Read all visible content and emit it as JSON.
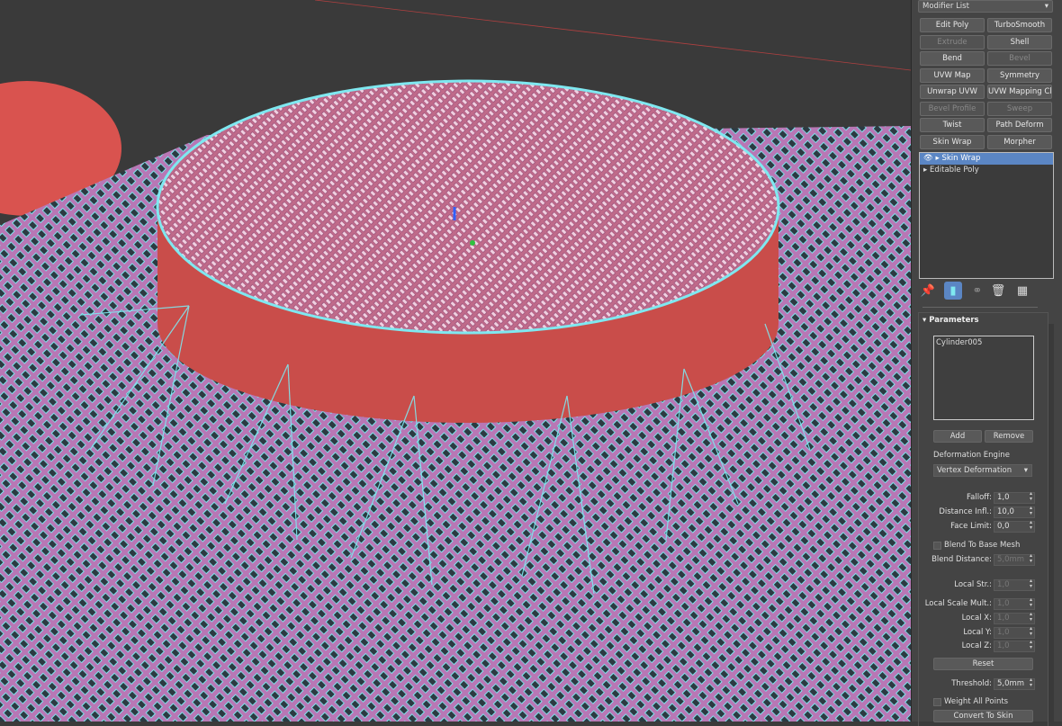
{
  "panel": {
    "modifier_list": "Modifier List",
    "buttons": [
      {
        "label": "Edit Poly",
        "enabled": true
      },
      {
        "label": "TurboSmooth",
        "enabled": true
      },
      {
        "label": "Extrude",
        "enabled": false
      },
      {
        "label": "Shell",
        "enabled": true
      },
      {
        "label": "Bend",
        "enabled": true
      },
      {
        "label": "Bevel",
        "enabled": false
      },
      {
        "label": "UVW Map",
        "enabled": true
      },
      {
        "label": "Symmetry",
        "enabled": true
      },
      {
        "label": "Unwrap UVW",
        "enabled": true
      },
      {
        "label": "UVW Mapping Clear",
        "enabled": true
      },
      {
        "label": "Bevel Profile",
        "enabled": false
      },
      {
        "label": "Sweep",
        "enabled": false
      },
      {
        "label": "Twist",
        "enabled": true
      },
      {
        "label": "Path Deform",
        "enabled": true
      },
      {
        "label": "Skin Wrap",
        "enabled": true
      },
      {
        "label": "Morpher",
        "enabled": true
      }
    ],
    "stack": [
      {
        "label": "Skin Wrap",
        "selected": true,
        "icon": "eye-icon"
      },
      {
        "label": "Editable Poly",
        "selected": false
      }
    ],
    "toolbar_icons": [
      "pin-stack-icon",
      "show-end-result-icon",
      "make-unique-icon",
      "remove-modifier-icon",
      "configure-modifier-sets-icon"
    ],
    "rollout_title": "Parameters",
    "target_list": [
      "Cylinder005"
    ],
    "add_label": "Add",
    "remove_label": "Remove",
    "deformation_engine_label": "Deformation Engine",
    "deformation_engine_value": "Vertex Deformation",
    "falloff": {
      "label": "Falloff:",
      "value": "1,0"
    },
    "distance_infl": {
      "label": "Distance Infl.:",
      "value": "10,0"
    },
    "face_limit": {
      "label": "Face Limit:",
      "value": "0,0"
    },
    "blend_to_base": {
      "label": "Blend To Base Mesh",
      "checked": false
    },
    "blend_distance": {
      "label": "Blend Distance:",
      "value": "5,0mm"
    },
    "local_str": {
      "label": "Local Str.:",
      "value": "1,0"
    },
    "local_scale_mult": {
      "label": "Local Scale Mult.:",
      "value": "1,0"
    },
    "local_x": {
      "label": "Local X:",
      "value": "1,0"
    },
    "local_y": {
      "label": "Local Y:",
      "value": "1,0"
    },
    "local_z": {
      "label": "Local Z:",
      "value": "1,0"
    },
    "reset_label": "Reset",
    "threshold": {
      "label": "Threshold:",
      "value": "5,0mm"
    },
    "weight_all_points": {
      "label": "Weight All Points",
      "checked": false
    },
    "convert_to_skin_label": "Convert To Skin"
  },
  "colors": {
    "wire": "#7fe8f0",
    "mesh": "#b0609a",
    "cylinder": "#d9534f",
    "selection": "#5b86c4"
  }
}
